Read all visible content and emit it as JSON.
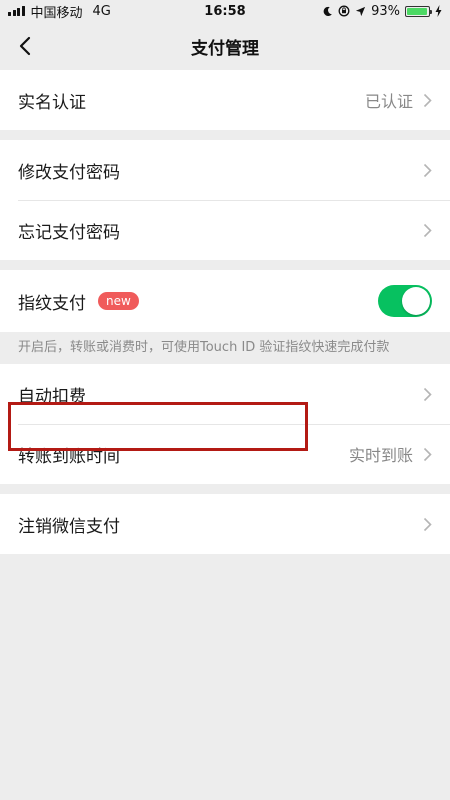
{
  "status_bar": {
    "carrier": "中国移动",
    "network": "4G",
    "time": "16:58",
    "battery_percent": "93%",
    "battery_level": 0.93,
    "icons": [
      "moon-icon",
      "lock-rotation-icon",
      "location-icon",
      "charging-icon"
    ]
  },
  "nav": {
    "title": "支付管理",
    "back_icon": "chevron-left-icon"
  },
  "groups": {
    "identity": {
      "label": "实名认证",
      "value": "已认证"
    },
    "password": {
      "change_label": "修改支付密码",
      "forgot_label": "忘记支付密码"
    },
    "fingerprint": {
      "label": "指纹支付",
      "badge": "new",
      "enabled": true,
      "hint": "开启后，转账或消费时，可使用Touch ID 验证指纹快速完成付款"
    },
    "payments": {
      "auto_deduct_label": "自动扣费",
      "transfer_time_label": "转账到账时间",
      "transfer_time_value": "实时到账"
    },
    "cancel": {
      "label": "注销微信支付"
    }
  },
  "colors": {
    "background": "#ededed",
    "toggle_on": "#07c160",
    "badge": "#f05b5b",
    "highlight": "#b31a14"
  }
}
